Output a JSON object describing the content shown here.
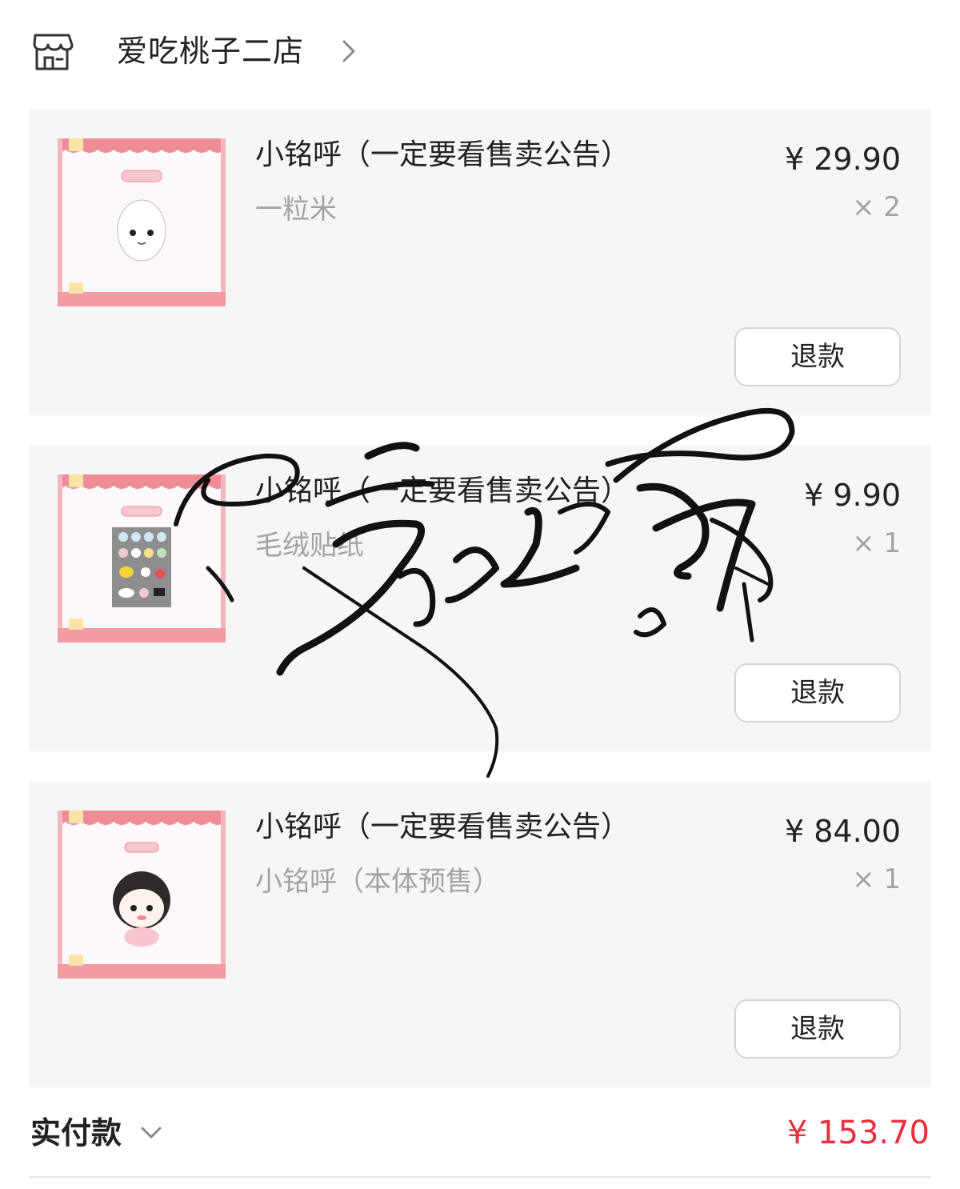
{
  "shop": {
    "name": "爱吃桃子二店",
    "icon": "store-icon",
    "chevron_icon": "chevron-right-icon"
  },
  "items": [
    {
      "title": "小铭呼（一定要看售卖公告）",
      "spec": "一粒米",
      "price": "¥ 29.90",
      "quantity": "× 2",
      "refund_label": "退款",
      "thumb_icon": "rice-grain-plush-image"
    },
    {
      "title": "小铭呼（一定要看售卖公告）",
      "spec": "毛绒贴纸",
      "price": "¥ 9.90",
      "quantity": "× 1",
      "refund_label": "退款",
      "thumb_icon": "plush-stickers-image"
    },
    {
      "title": "小铭呼（一定要看售卖公告）",
      "spec": "小铭呼（本体预售）",
      "price": "¥ 84.00",
      "quantity": "× 1",
      "refund_label": "退款",
      "thumb_icon": "doll-body-image"
    }
  ],
  "summary": {
    "label": "实付款",
    "total": "¥ 153.70",
    "chevron_icon": "chevron-down-icon"
  },
  "watermark": {
    "text": "爱吃兔子牙",
    "kind": "handwritten-signature"
  },
  "colors": {
    "price_total": "#e6303c",
    "card_bg": "#f5f6f8",
    "muted_text": "#a3a3a3",
    "thumb_accent": "#f08c96"
  }
}
